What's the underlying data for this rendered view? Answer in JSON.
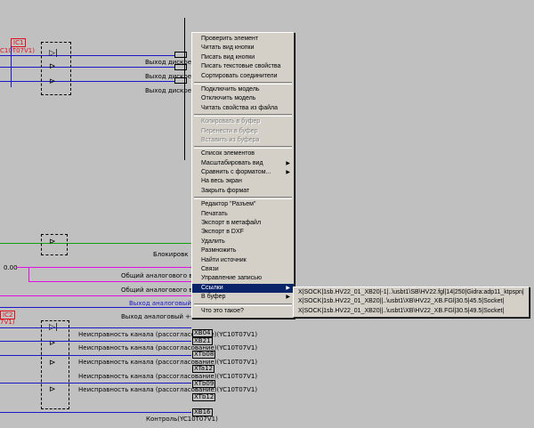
{
  "schematic": {
    "ic1": {
      "ref": "IC1",
      "part": "C10T07V1)"
    },
    "ic2": {
      "ref": "IC2",
      "part": "7V1)"
    },
    "left_value": "0.00",
    "outputs": [
      {
        "label": "Выход дискретный"
      },
      {
        "label": "Выход дискретный"
      },
      {
        "label": "Выход дискретный"
      }
    ],
    "block_label": "Блокировк",
    "analog": [
      {
        "label": "Общий аналогового выход"
      },
      {
        "label": "Общий аналогового выхо"
      },
      {
        "label": "Выход аналоговый +-5"
      },
      {
        "label": "Выход аналоговый +-100"
      }
    ],
    "faults": [
      {
        "label": "Неисправность канала (рассогласование)(YC10T07V1)",
        "tag": "XB04"
      },
      {
        "label": "Неисправность канала (рассогласование)(YC10T07V1)",
        "tag": "XB21"
      },
      {
        "label": "Неисправность канала (рассогласование)(YC10T07V1)",
        "tag": "XTb08"
      },
      {
        "label": "",
        "tag": "XTa12"
      },
      {
        "label": "Неисправность канала (рассогласование)(YC10T07V1)",
        "tag": "XTb09"
      },
      {
        "label": "Неисправность канала (рассогласование)(YC10T07V1)",
        "tag": "XTb12"
      },
      {
        "label": "",
        "tag": "XB16"
      },
      {
        "label": "Контроль(YC10T07V1)",
        "tag": ""
      }
    ]
  },
  "context_menu": {
    "items": [
      {
        "label": "Проверить элемент"
      },
      {
        "label": "Читать вид кнопки"
      },
      {
        "label": "Писать вид кнопки"
      },
      {
        "label": "Писать текстовые свойства"
      },
      {
        "label": "Сортировать соединители"
      },
      {
        "label": "Подключить модель"
      },
      {
        "label": "Отключить модель"
      },
      {
        "label": "Читать свойства из файла"
      },
      {
        "label": "Копировать в буфер"
      },
      {
        "label": "Перенести в буфер"
      },
      {
        "label": "Вставить из буфера"
      },
      {
        "label": "Список элементов"
      },
      {
        "label": "Масштабировать вид"
      },
      {
        "label": "Сравнить с форматом..."
      },
      {
        "label": "На весь экран"
      },
      {
        "label": "Закрыть формат"
      },
      {
        "label": "Редактор \"Разъем\""
      },
      {
        "label": "Печатать"
      },
      {
        "label": "Экспорт в метафайл"
      },
      {
        "label": "Экспорт в DXF"
      },
      {
        "label": "Удалить"
      },
      {
        "label": "Размножить"
      },
      {
        "label": "Найти источник"
      },
      {
        "label": "Связи"
      },
      {
        "label": "Управление записью"
      },
      {
        "label": "Ссылки"
      },
      {
        "label": "В буфер"
      },
      {
        "label": "Что это такое?"
      }
    ]
  },
  "links_submenu": {
    "items": [
      {
        "label": "X|SOCK|1sb.HV22_01_XB20|-1|..\\usbt1\\SB\\HV22.fgl|14|250|Gidra:adp11_ktpspn|"
      },
      {
        "label": "X|SOCK|1sb.HV22_01_XB20||..\\usbt1\\XB\\HV22_XB.FGl|30.5|45.5|Socket|"
      },
      {
        "label": "X|SOCK|1sb.HV22_01_XB20||..\\usbt1\\XB\\HV22_XB.FGl|30.5|49.5|Socket|"
      }
    ]
  },
  "colors": {
    "background": "#c0c0c0",
    "wire_blue": "#1818c8",
    "wire_green": "#10a010",
    "wire_magenta": "#e010e0",
    "ic_red": "#e0101a",
    "menu_bg": "#d4d0c8",
    "highlight": "#0a246a"
  }
}
